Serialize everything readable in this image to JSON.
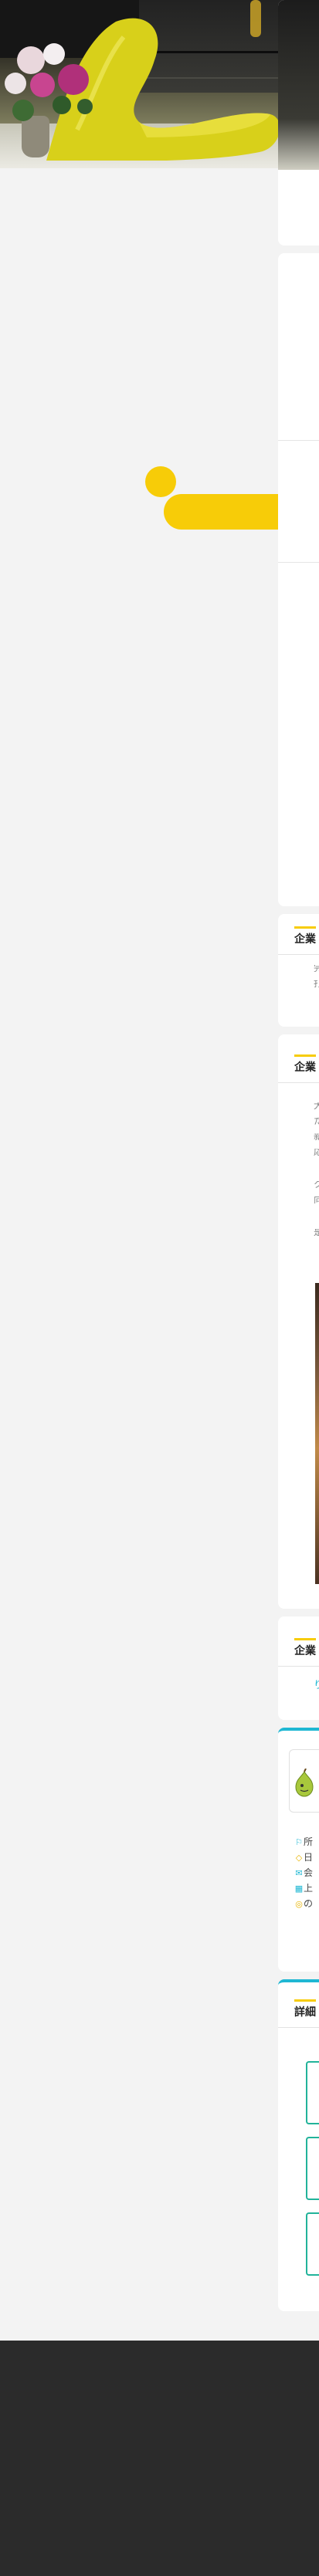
{
  "hero": {
    "image_alt": "lounge chair and flowers photo"
  },
  "sections": {
    "s1": {
      "title": "企業",
      "lines": [
        "完",
        "打"
      ]
    },
    "s2": {
      "title": "企業",
      "lines": [
        "大",
        "た",
        "新",
        "応",
        "ク",
        "向",
        "是"
      ]
    },
    "s3": {
      "title": "企業",
      "link": "り"
    },
    "s4": {
      "rows": [
        {
          "icon": "flag-icon",
          "glyph": "⚐",
          "text": "所"
        },
        {
          "icon": "tag-icon",
          "glyph": "◇",
          "text": "日"
        },
        {
          "icon": "mail-icon",
          "glyph": "✉",
          "text": "会"
        },
        {
          "icon": "building-icon",
          "glyph": "▦",
          "text": "上"
        },
        {
          "icon": "coin-icon",
          "glyph": "◎",
          "text": "の"
        }
      ]
    },
    "s5": {
      "title": "詳細"
    }
  },
  "colors": {
    "accent_yellow": "#f7cc08",
    "accent_cyan": "#1fb7d3",
    "accent_green": "#22b39a",
    "footer_bg": "#2b2b2b"
  }
}
